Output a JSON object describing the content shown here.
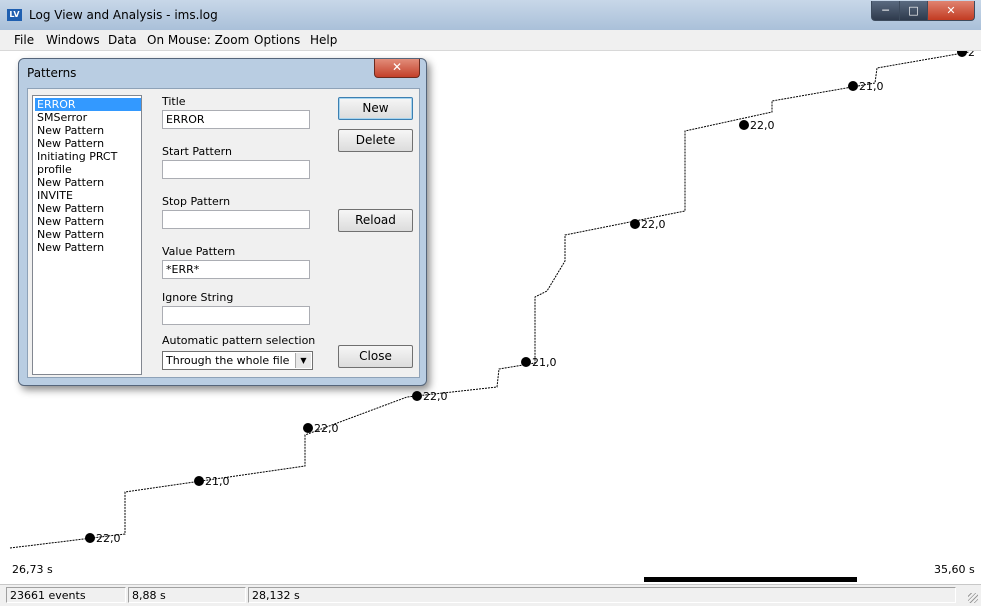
{
  "window": {
    "title": "Log View and Analysis - ims.log",
    "app_icon": "lva-app-icon"
  },
  "menu": [
    "File",
    "Windows",
    "Data",
    "On Mouse: Zoom",
    "Options",
    "Help"
  ],
  "plot": {
    "x_start_label": "26,73 s",
    "x_end_label": "35,60 s",
    "markers": [
      {
        "label": "22,0"
      },
      {
        "label": "21,0"
      },
      {
        "label": "22,0"
      },
      {
        "label": "22,0"
      },
      {
        "label": "21,0"
      },
      {
        "label": "22,0"
      },
      {
        "label": "22,0"
      },
      {
        "label": "21,0"
      },
      {
        "label": "2"
      }
    ]
  },
  "status": {
    "events": "23661 events",
    "duration": "8,88 s",
    "position": "28,132 s"
  },
  "dialog": {
    "title": "Patterns",
    "patterns": [
      "ERROR",
      "SMSerror",
      "New Pattern",
      "New Pattern",
      "Initiating PRCT",
      "profile",
      "New Pattern",
      "INVITE",
      "New Pattern",
      "New Pattern",
      "New Pattern",
      "New Pattern"
    ],
    "selected_index": 0,
    "fields": {
      "title_label": "Title",
      "title_value": "ERROR",
      "start_label": "Start Pattern",
      "start_value": "",
      "stop_label": "Stop Pattern",
      "stop_value": "",
      "value_label": "Value Pattern",
      "value_value": "*ERR*",
      "ignore_label": "Ignore String",
      "ignore_value": "",
      "auto_label": "Automatic pattern selection",
      "auto_value": "Through the whole file"
    },
    "buttons": {
      "new": "New",
      "delete": "Delete",
      "reload": "Reload",
      "close": "Close"
    }
  }
}
